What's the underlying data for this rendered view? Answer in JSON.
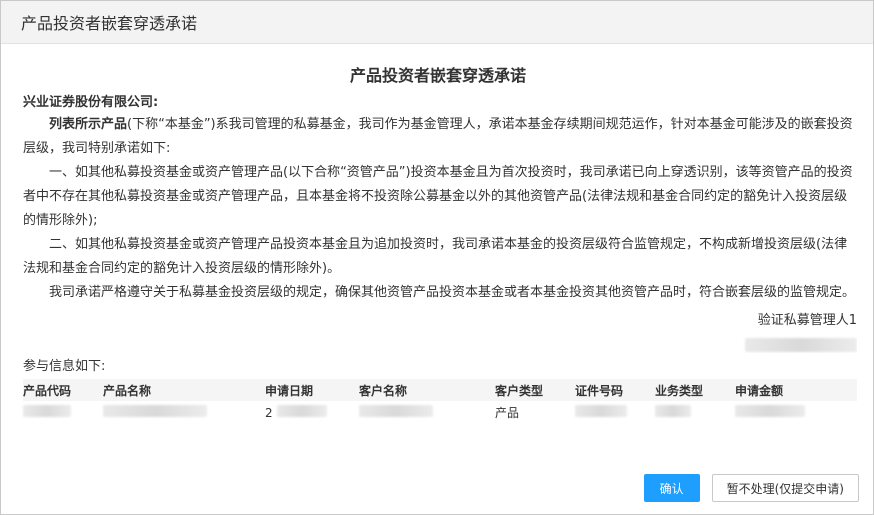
{
  "dialog": {
    "title": "产品投资者嵌套穿透承诺",
    "doc_title": "产品投资者嵌套穿透承诺",
    "addressee": "兴业证券股份有限公司:",
    "p1_bold": "列表所示产品",
    "p1_rest": "(下称“本基金”)系我司管理的私募基金，我司作为基金管理人，承诺本基金存续期间规范运作，针对本基金可能涉及的嵌套投资层级，我司特别承诺如下:",
    "p2": "一、如其他私募投资基金或资产管理产品(以下合称“资管产品”)投资本基金且为首次投资时，我司承诺已向上穿透识别，该等资管产品的投资者中不存在其他私募投资基金或资产管理产品，且本基金将不投资除公募基金以外的其他资管产品(法律法规和基金合同约定的豁免计入投资层级的情形除外);",
    "p3": "二、如其他私募投资基金或资产管理产品投资本基金且为追加投资时，我司承诺本基金的投资层级符合监管规定，不构成新增投资层级(法律法规和基金合同约定的豁免计入投资层级的情形除外)。",
    "p4": "我司承诺严格遵守关于私募基金投资层级的规定，确保其他资管产品投资本基金或者本基金投资其他资管产品时，符合嵌套层级的监管规定。",
    "signer": "验证私募管理人1",
    "info_label": "参与信息如下:"
  },
  "table": {
    "headers": [
      "产品代码",
      "产品名称",
      "申请日期",
      "客户名称",
      "客户类型",
      "证件号码",
      "业务类型",
      "申请金额"
    ],
    "row": {
      "product_code": "",
      "product_name": "",
      "apply_date": "2",
      "customer_name": "",
      "customer_type": "产品",
      "id_number": "",
      "business_type": "",
      "amount": ""
    }
  },
  "buttons": {
    "confirm": "确认",
    "defer": "暂不处理(仅提交申请)"
  },
  "colors": {
    "primary": "#1e9fff",
    "titlebar": "#f3f3f3"
  }
}
